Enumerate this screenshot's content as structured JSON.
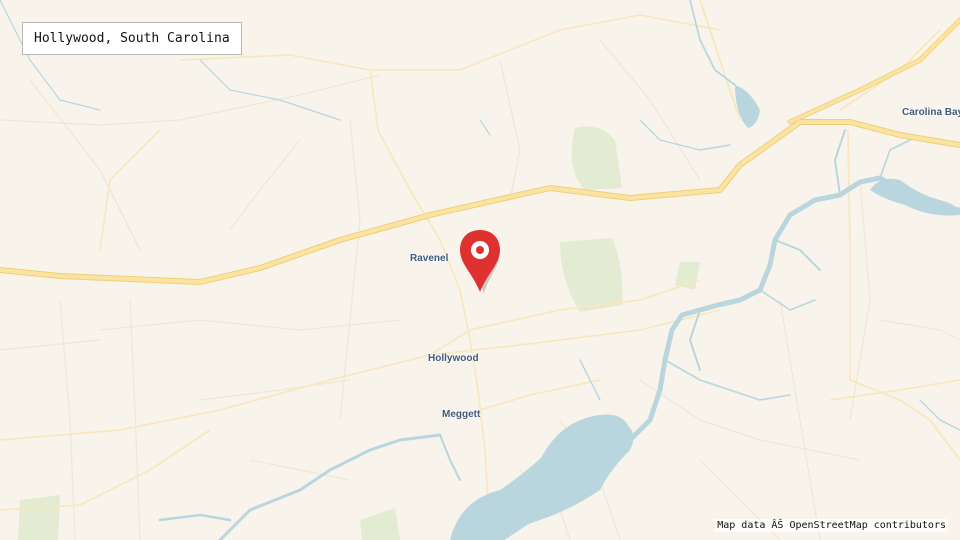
{
  "title": "Hollywood, South Carolina",
  "places": {
    "ravenel": "Ravenel",
    "hollywood": "Hollywood",
    "meggett": "Meggett",
    "carolina_bay": "Carolina Bay"
  },
  "attribution": "Map data ÂŠ OpenStreetMap contributors",
  "marker_icon": "map-pin-icon",
  "colors": {
    "land": "#f8f4ec",
    "water": "#b9d6de",
    "green": "#e3ebd2",
    "major_road": "#fbe3a2",
    "minor_road": "#f2e9dc",
    "marker": "#e03131",
    "label": "#41597a"
  }
}
